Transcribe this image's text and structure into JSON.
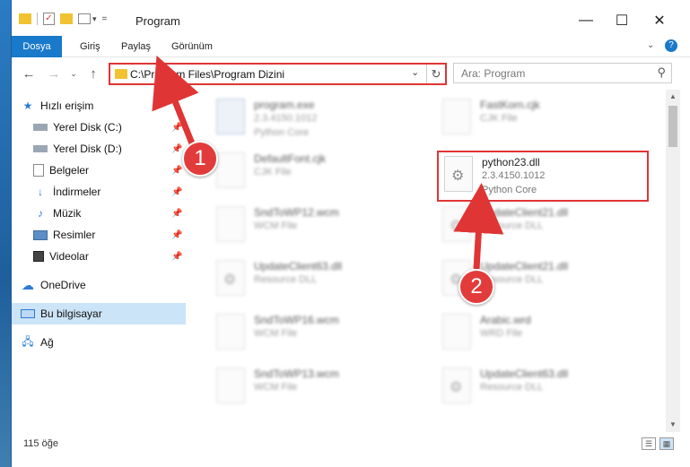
{
  "window": {
    "title": "Program"
  },
  "ribbon": {
    "tabs": [
      "Dosya",
      "Giriş",
      "Paylaş",
      "Görünüm"
    ]
  },
  "address": {
    "path": "C:\\Program Files\\Program Dizini"
  },
  "search": {
    "placeholder": "Ara: Program"
  },
  "sidebar": {
    "items": [
      {
        "label": "Hızlı erişim",
        "icon": "star-icon"
      },
      {
        "label": "Yerel Disk (C:)",
        "icon": "drive-icon",
        "pinned": true
      },
      {
        "label": "Yerel Disk (D:)",
        "icon": "drive-icon",
        "pinned": true
      },
      {
        "label": "Belgeler",
        "icon": "documents-icon",
        "pinned": true
      },
      {
        "label": "İndirmeler",
        "icon": "download-icon",
        "pinned": true
      },
      {
        "label": "Müzik",
        "icon": "music-icon",
        "pinned": true
      },
      {
        "label": "Resimler",
        "icon": "pictures-icon",
        "pinned": true
      },
      {
        "label": "Videolar",
        "icon": "video-icon",
        "pinned": true
      },
      {
        "label": "OneDrive",
        "icon": "cloud-icon"
      },
      {
        "label": "Bu bilgisayar",
        "icon": "computer-icon",
        "selected": true
      },
      {
        "label": "Ağ",
        "icon": "network-icon"
      }
    ]
  },
  "files": [
    {
      "name": "program.exe",
      "version": "2.3.4150.1012",
      "type": "Python Core",
      "icon": "exe-icon"
    },
    {
      "name": "FastKorn.cjk",
      "version": "CJK File",
      "type": "",
      "icon": "file-icon"
    },
    {
      "name": "DefaultFont.cjk",
      "version": "CJK File",
      "type": "",
      "icon": "file-icon"
    },
    {
      "name": "python23.dll",
      "version": "2.3.4150.1012",
      "type": "Python Core",
      "icon": "dll-icon"
    },
    {
      "name": "SndToWP12.wcm",
      "version": "WCM File",
      "type": "",
      "icon": "file-icon"
    },
    {
      "name": "UpdateClient21.dll",
      "version": "Resource DLL",
      "type": "",
      "icon": "dll-icon"
    },
    {
      "name": "UpdateClient63.dll",
      "version": "Resource DLL",
      "type": "",
      "icon": "dll-icon"
    },
    {
      "name": "UpdateClient21.dll",
      "version": "Resource DLL",
      "type": "",
      "icon": "dll-icon"
    },
    {
      "name": "SndToWP16.wcm",
      "version": "WCM File",
      "type": "",
      "icon": "file-icon"
    },
    {
      "name": "Arabic.wrd",
      "version": "WRD File",
      "type": "",
      "icon": "file-icon"
    },
    {
      "name": "SndToWP13.wcm",
      "version": "WCM File",
      "type": "",
      "icon": "file-icon"
    },
    {
      "name": "UpdateClient63.dll",
      "version": "Resource DLL",
      "type": "",
      "icon": "dll-icon"
    }
  ],
  "annotations": {
    "step1": "1",
    "step2": "2",
    "accent": "#e03535"
  },
  "status": {
    "count": "115 öğe"
  }
}
